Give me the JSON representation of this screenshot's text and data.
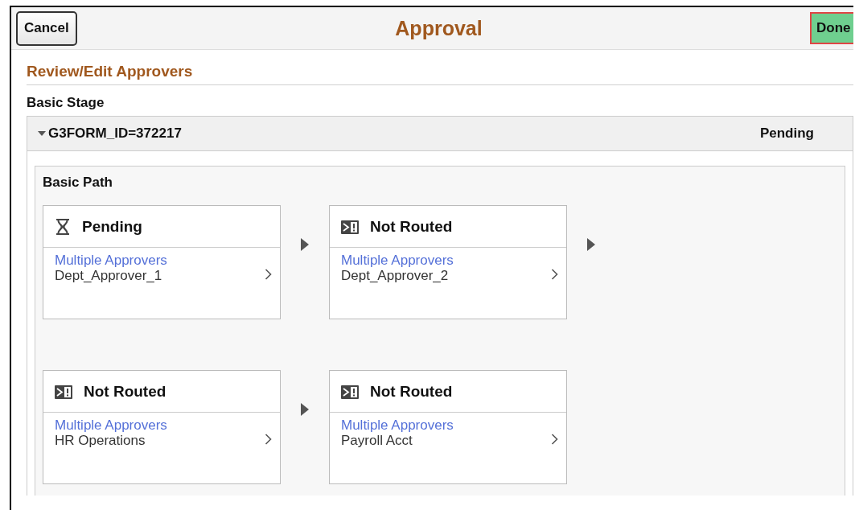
{
  "header": {
    "cancel": "Cancel",
    "title": "Approval",
    "done": "Done"
  },
  "section_title": "Review/Edit Approvers",
  "stage": {
    "label": "Basic Stage",
    "id": "G3FORM_ID=372217",
    "status": "Pending",
    "expanded": true,
    "path": {
      "label": "Basic Path",
      "rows": [
        {
          "steps": [
            {
              "kind": "pending",
              "status": "Pending",
              "link": "Multiple Approvers",
              "approver": "Dept_Approver_1",
              "arrow_after": true
            },
            {
              "kind": "not_routed",
              "status": "Not Routed",
              "link": "Multiple Approvers",
              "approver": "Dept_Approver_2",
              "arrow_after": true
            }
          ]
        },
        {
          "steps": [
            {
              "kind": "not_routed",
              "status": "Not Routed",
              "link": "Multiple Approvers",
              "approver": "HR Operations",
              "arrow_after": true
            },
            {
              "kind": "not_routed",
              "status": "Not Routed",
              "link": "Multiple Approvers",
              "approver": "Payroll Acct",
              "arrow_after": false
            }
          ]
        }
      ]
    }
  }
}
